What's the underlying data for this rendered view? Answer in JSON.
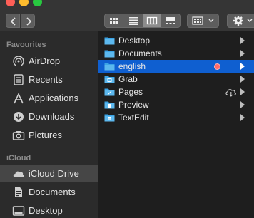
{
  "window": {
    "accent_color": "#0f5fd0",
    "traffic_lights": [
      "#fe5f57",
      "#febc2e",
      "#28c840"
    ]
  },
  "toolbar": {
    "nav": [
      "chevron-left-icon",
      "chevron-right-icon"
    ],
    "views": [
      "icon-view",
      "list-view",
      "column-view",
      "gallery-view"
    ],
    "selected_view": "column-view"
  },
  "sidebar": {
    "favourites_label": "Favourites",
    "icloud_label": "iCloud",
    "favourites": [
      {
        "label": "AirDrop",
        "icon": "airdrop-icon"
      },
      {
        "label": "Recents",
        "icon": "recents-icon"
      },
      {
        "label": "Applications",
        "icon": "applications-icon"
      },
      {
        "label": "Downloads",
        "icon": "downloads-icon"
      },
      {
        "label": "Pictures",
        "icon": "pictures-icon"
      }
    ],
    "icloud": [
      {
        "label": "iCloud Drive",
        "icon": "icloud-drive-icon",
        "selected": true
      },
      {
        "label": "Documents",
        "icon": "documents-icon"
      },
      {
        "label": "Desktop",
        "icon": "desktop-icon"
      }
    ]
  },
  "column": {
    "items": [
      {
        "name": "Desktop",
        "kind": "folder"
      },
      {
        "name": "Documents",
        "kind": "folder"
      },
      {
        "name": "english",
        "kind": "folder",
        "selected": true,
        "tag_color": "#ff6b6b"
      },
      {
        "name": "Grab",
        "kind": "app"
      },
      {
        "name": "Pages",
        "kind": "app",
        "cloud": true
      },
      {
        "name": "Preview",
        "kind": "app"
      },
      {
        "name": "TextEdit",
        "kind": "app"
      }
    ]
  }
}
